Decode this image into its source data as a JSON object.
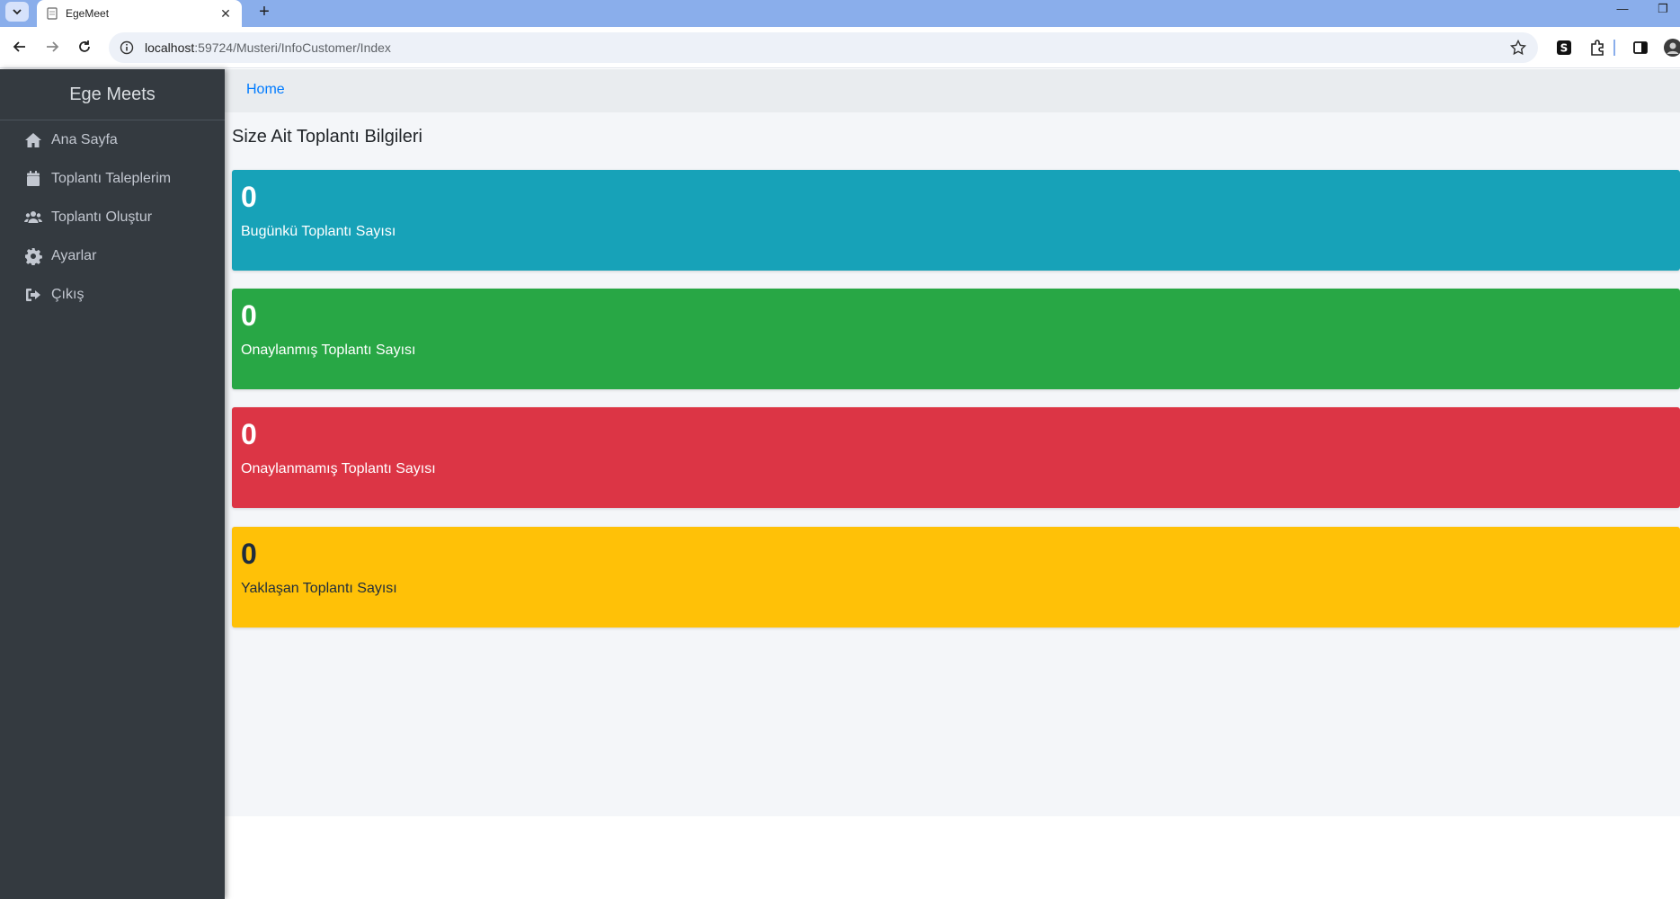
{
  "browser": {
    "tab_title": "EgeMeet",
    "tab_close": "✕",
    "new_tab": "+",
    "url_host": "localhost",
    "url_rest": ":59724/Musteri/InfoCustomer/Index",
    "minimize": "—",
    "restore": "❐"
  },
  "sidebar": {
    "brand": "Ege Meets",
    "items": [
      {
        "label": "Ana Sayfa",
        "icon": "home-icon"
      },
      {
        "label": "Toplantı Taleplerim",
        "icon": "calendar-icon"
      },
      {
        "label": "Toplantı Oluştur",
        "icon": "users-icon"
      },
      {
        "label": "Ayarlar",
        "icon": "gear-icon"
      },
      {
        "label": "Çıkış",
        "icon": "sign-out-icon"
      }
    ]
  },
  "breadcrumb": {
    "home": "Home"
  },
  "main": {
    "title": "Size Ait Toplantı Bilgileri",
    "boxes": [
      {
        "value": "0",
        "label": "Bugünkü Toplantı Sayısı",
        "color": "#17a2b8"
      },
      {
        "value": "0",
        "label": "Onaylanmış Toplantı Sayısı",
        "color": "#28a745"
      },
      {
        "value": "0",
        "label": "Onaylanmamış Toplantı Sayısı",
        "color": "#dc3545"
      },
      {
        "value": "0",
        "label": "Yaklaşan Toplantı Sayısı",
        "color": "#ffc107"
      }
    ]
  }
}
